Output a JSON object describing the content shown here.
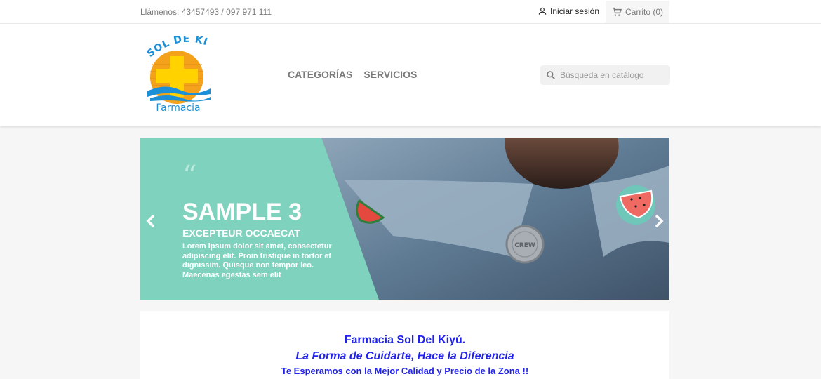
{
  "topbar": {
    "contact": "Llámenos: 43457493 / 097 971 111",
    "login_label": "Iniciar sesión",
    "cart_label": "Carrito (0)"
  },
  "header": {
    "logo": {
      "arc_text": "SOL DE KIYÚ",
      "sub_text": "Farmacia"
    },
    "nav": [
      "CATEGORÍAS",
      "SERVICIOS"
    ],
    "search_placeholder": "Búsqueda en catálogo"
  },
  "carousel": {
    "quote_mark": "“",
    "title": "SAMPLE 3",
    "subtitle": "EXCEPTEUR OCCAECAT",
    "text": "Lorem ipsum dolor sit amet, consectetur adipiscing elit. Proin tristique in tortor et dignissim. Quisque non tempor leo. Maecenas egestas sem elit",
    "pin_text": "CREW"
  },
  "content": {
    "line1": "Farmacia Sol Del Kiyú.",
    "line2": "La Forma de Cuidarte, Hace la Diferencia",
    "line3": "Te Esperamos con la Mejor Calidad y Precio de la Zona !!"
  },
  "colors": {
    "accent_teal": "#7fd2bd",
    "brand_blue": "#2222ee",
    "logo_orange": "#f4a11c",
    "logo_yellow": "#ffd200",
    "logo_blue": "#1d8fd6"
  }
}
